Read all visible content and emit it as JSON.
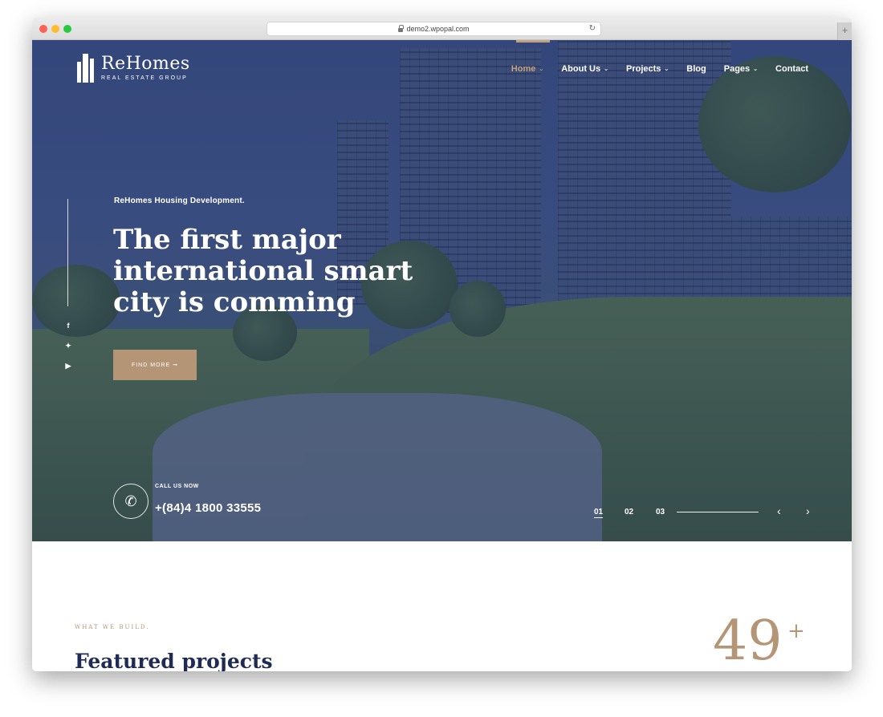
{
  "browser": {
    "url": "demo2.wpopal.com"
  },
  "brand": {
    "name": "ReHomes",
    "tagline": "REAL ESTATE GROUP",
    "accent_color": "#c3a17c"
  },
  "nav": {
    "items": [
      {
        "label": "Home",
        "has_dropdown": true,
        "active": true
      },
      {
        "label": "About Us",
        "has_dropdown": true,
        "active": false
      },
      {
        "label": "Projects",
        "has_dropdown": true,
        "active": false
      },
      {
        "label": "Blog",
        "has_dropdown": false,
        "active": false
      },
      {
        "label": "Pages",
        "has_dropdown": true,
        "active": false
      },
      {
        "label": "Contact",
        "has_dropdown": false,
        "active": false
      }
    ]
  },
  "social": {
    "icons": [
      "facebook-icon",
      "twitter-icon",
      "youtube-icon"
    ]
  },
  "hero": {
    "eyebrow": "ReHomes Housing Development.",
    "headline_line1": "The first major",
    "headline_line2": "international smart",
    "headline_line3": "city is comming",
    "button_label": "FIND MORE ➞",
    "call_label": "CALL US NOW",
    "phone": "+(84)4 1800 33555",
    "slides": [
      "01",
      "02",
      "03"
    ],
    "active_slide": "01"
  },
  "featured": {
    "eyebrow": "WHAT WE BUILD.",
    "title": "Featured projects",
    "count": "49",
    "count_suffix": "+"
  }
}
